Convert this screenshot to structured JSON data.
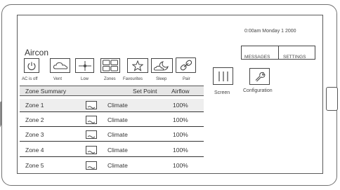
{
  "header": {
    "datetime": "0:00am Monday 1 2000",
    "title": "Aircon"
  },
  "mode_buttons": [
    {
      "label": "AC is off",
      "icon": "power-icon"
    },
    {
      "label": "Vent",
      "icon": "cloud-icon"
    },
    {
      "label": "Low",
      "icon": "fan-speed-icon"
    },
    {
      "label": "Zones",
      "icon": "zones-grid-icon"
    },
    {
      "label": "Favourites",
      "icon": "star-icon"
    },
    {
      "label": "Sleep",
      "icon": "moon-cloud-icon"
    },
    {
      "label": "Pair",
      "icon": "pair-link-icon"
    }
  ],
  "top_right": {
    "messages": "MESSAGES",
    "settings": "SETTINGS"
  },
  "side_buttons": [
    {
      "label": "Screen",
      "icon": "screen-bars-icon"
    },
    {
      "label": "Configuration",
      "icon": "wrench-icon"
    }
  ],
  "table": {
    "headers": {
      "zone": "Zone Summary",
      "setpoint": "Set Point",
      "airflow": "Airflow"
    },
    "rows": [
      {
        "zone": "Zone 1",
        "mode": "Climate",
        "airflow": "100%"
      },
      {
        "zone": "Zone 2",
        "mode": "Climate",
        "airflow": "100%"
      },
      {
        "zone": "Zone 3",
        "mode": "Climate",
        "airflow": "100%"
      },
      {
        "zone": "Zone 4",
        "mode": "Climate",
        "airflow": "100%"
      },
      {
        "zone": "Zone 5",
        "mode": "Climate",
        "airflow": "100%"
      }
    ]
  },
  "colors": {
    "outline": "#444444",
    "header_bg": "#e6e6e6",
    "row_highlight": "#eeeeee"
  }
}
